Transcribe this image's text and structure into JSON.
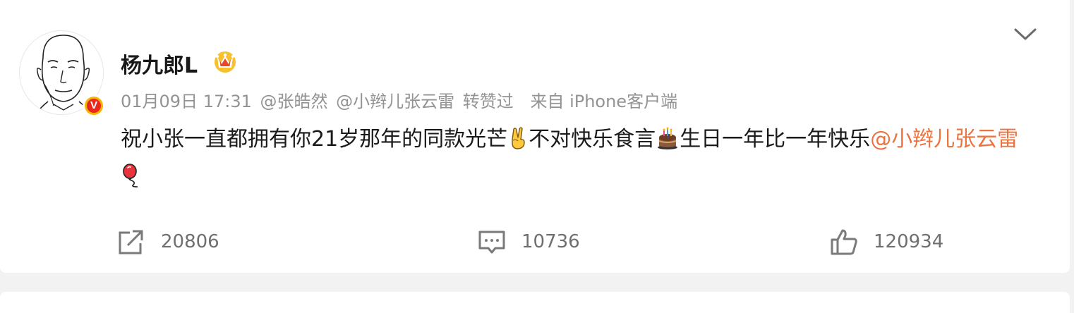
{
  "post": {
    "author": {
      "name": "杨九郎L",
      "verified_badge": "V",
      "member_icon": "crown-icon"
    },
    "meta": {
      "timestamp": "01月09日 17:31",
      "mention_1": "@张皓然",
      "mention_2": "@小辫儿张云雷",
      "liked_by_label": "转赞过",
      "source": "来自 iPhone客户端"
    },
    "content": {
      "text_1": "祝小张一直都拥有你21岁那年的同款光芒",
      "emoji_1": "victory-hand-icon",
      "text_2": "不对快乐食言",
      "emoji_2": "cake-icon",
      "text_3": "生日一年比一年快乐",
      "mention": "@小辫儿张云雷",
      "emoji_3": "balloon-icon"
    },
    "actions": {
      "repost_count": "20806",
      "comment_count": "10736",
      "like_count": "120934"
    }
  },
  "colors": {
    "mention": "#eb7340",
    "meta_text": "#939393",
    "action_text": "#6f6f6f",
    "badge_red": "#e8281f",
    "badge_gold": "#f7b500"
  }
}
